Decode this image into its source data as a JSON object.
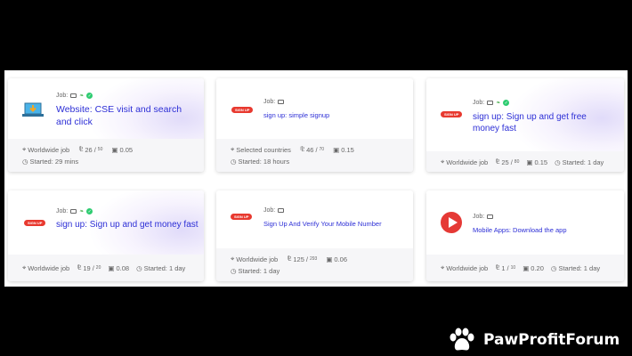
{
  "job_prefix": "Job:",
  "badge_text": "SIGN UP",
  "cards": [
    {
      "title": "Website: CSE visit and search and click",
      "region": "Worldwide job",
      "progress": "26",
      "total": "50",
      "reward": "0.05",
      "started": "Started: 29 mins"
    },
    {
      "title": "sign up: simple signup",
      "region": "Selected countries",
      "progress": "46",
      "total": "70",
      "reward": "0.15",
      "started": "Started: 18 hours"
    },
    {
      "title": "sign up: Sign up and get free money fast",
      "region": "Worldwide job",
      "progress": "25",
      "total": "80",
      "reward": "0.15",
      "started": "Started: 1 day"
    },
    {
      "title": "sign up: Sign up and get money fast",
      "region": "Worldwide job",
      "progress": "19",
      "total": "20",
      "reward": "0.08",
      "started": "Started: 1 day"
    },
    {
      "title": "Sign Up And Verify Your Mobile Number",
      "region": "Worldwide job",
      "progress": "125",
      "total": "293",
      "reward": "0.06",
      "started": "Started: 1 day"
    },
    {
      "title": "Mobile Apps: Download the app",
      "region": "Worldwide job",
      "progress": "1",
      "total": "10",
      "reward": "0.20",
      "started": "Started: 1 day"
    }
  ],
  "brand": {
    "name": "PawProfitForum",
    "icon": "paw-icon"
  },
  "colors": {
    "title": "#2d2fd6",
    "badge": "#e8392f",
    "check": "#2ecc71"
  }
}
